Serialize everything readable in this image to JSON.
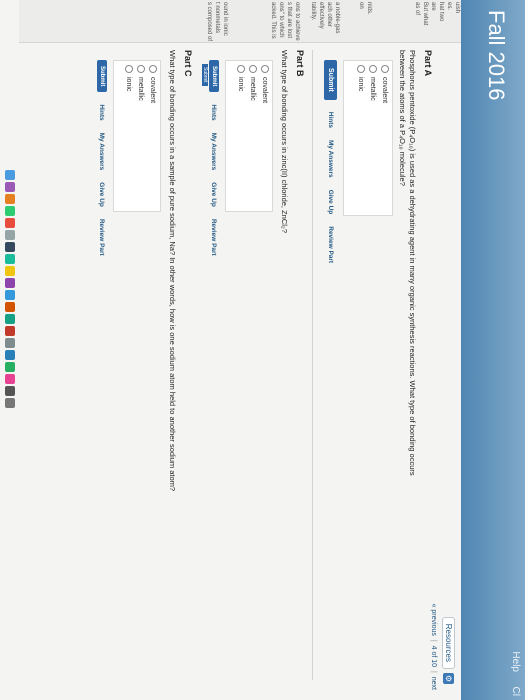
{
  "header": {
    "course_title": "Fall 2016",
    "help": "Help",
    "close": "Cl"
  },
  "toolbar": {
    "resources": "Resources"
  },
  "nav": {
    "previous": "« previous",
    "position": "4 of 10",
    "next": "next"
  },
  "sidebar": {
    "lines": [
      "uish",
      "es.",
      "hat two",
      "are",
      "But what",
      "as of",
      "",
      "",
      "",
      "",
      "",
      "nids.",
      "on",
      "",
      "",
      "a noble-gas",
      "ach other",
      "effectively",
      "tability.",
      "",
      "ons to achieve",
      "s that are lost",
      "ons\" to which",
      "acked. This is",
      "",
      "",
      "",
      "",
      "",
      "ound in ionic",
      "t nonmetals",
      "s composed of a"
    ]
  },
  "partA": {
    "heading": "Part A",
    "question_prefix": "Phosphorus pentoxide (",
    "formula": "P₄O₁₀",
    "question_suffix": ") is used as a dehydrating agent in many organic synthesis reactions. What type of bonding occurs",
    "question_line2_prefix": "between the atoms of a",
    "formula2": "P₄O₁₀",
    "question_line2_suffix": "molecule?",
    "options": [
      "covalent",
      "metallic",
      "ionic"
    ],
    "submit": "Submit",
    "hints": "Hints",
    "my_answers": "My Answers",
    "give_up": "Give Up",
    "review": "Review Part"
  },
  "partB": {
    "heading": "Part B",
    "question_prefix": "What type of bonding occurs in zinc(II) chloride,",
    "formula": "ZnCl₂",
    "question_suffix": "?",
    "options": [
      "covalent",
      "metallic",
      "ionic"
    ],
    "submit": "Submit",
    "submitted": "Submit",
    "hints": "Hints",
    "my_answers": "My Answers",
    "give_up": "Give Up",
    "review": "Review Part"
  },
  "partC": {
    "heading": "Part C",
    "question_prefix": "What type of bonding occurs in a sample of pure sodium,",
    "formula": "Na",
    "question_suffix": "? In other words, how is one sodium atom held to another sodium atom?",
    "options": [
      "covalent",
      "metallic",
      "ionic"
    ],
    "submit": "Submit",
    "hints": "Hints",
    "my_answers": "My Answers",
    "give_up": "Give Up",
    "review": "Review Part"
  },
  "colors": {
    "header_top": "#7fa9c9",
    "header_bottom": "#4f86b2",
    "submit_blue": "#2d67a8",
    "link_blue": "#245a86"
  }
}
